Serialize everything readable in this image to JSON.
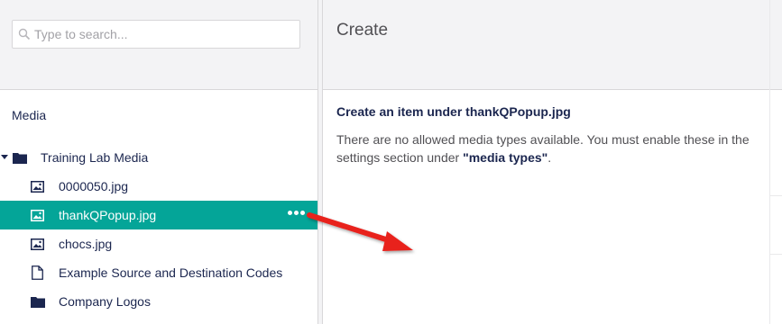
{
  "search": {
    "placeholder": "Type to search..."
  },
  "tree": {
    "section_title": "Media",
    "root": {
      "label": "Training Lab Media",
      "icon": "folder-icon",
      "expanded": true
    },
    "items": [
      {
        "label": "0000050.jpg",
        "icon": "image-icon",
        "selected": false
      },
      {
        "label": "thankQPopup.jpg",
        "icon": "image-icon",
        "selected": true
      },
      {
        "label": "chocs.jpg",
        "icon": "image-icon",
        "selected": false
      },
      {
        "label": "Example Source and Destination Codes",
        "icon": "file-icon",
        "selected": false
      },
      {
        "label": "Company Logos",
        "icon": "folder-icon",
        "selected": false
      }
    ],
    "more_actions_icon": "more-dots-icon"
  },
  "dialog": {
    "title": "Create",
    "heading": "Create an item under thankQPopup.jpg",
    "message_prefix": "There are no allowed media types available. You must enable these in the settings section under ",
    "message_link": "\"media types\"",
    "message_suffix": "."
  },
  "colors": {
    "accent": "#04a598",
    "text": "#1b264f",
    "header_bg": "#f3f3f5",
    "border": "#d8d7d9",
    "annotation_arrow": "#e8211e"
  }
}
